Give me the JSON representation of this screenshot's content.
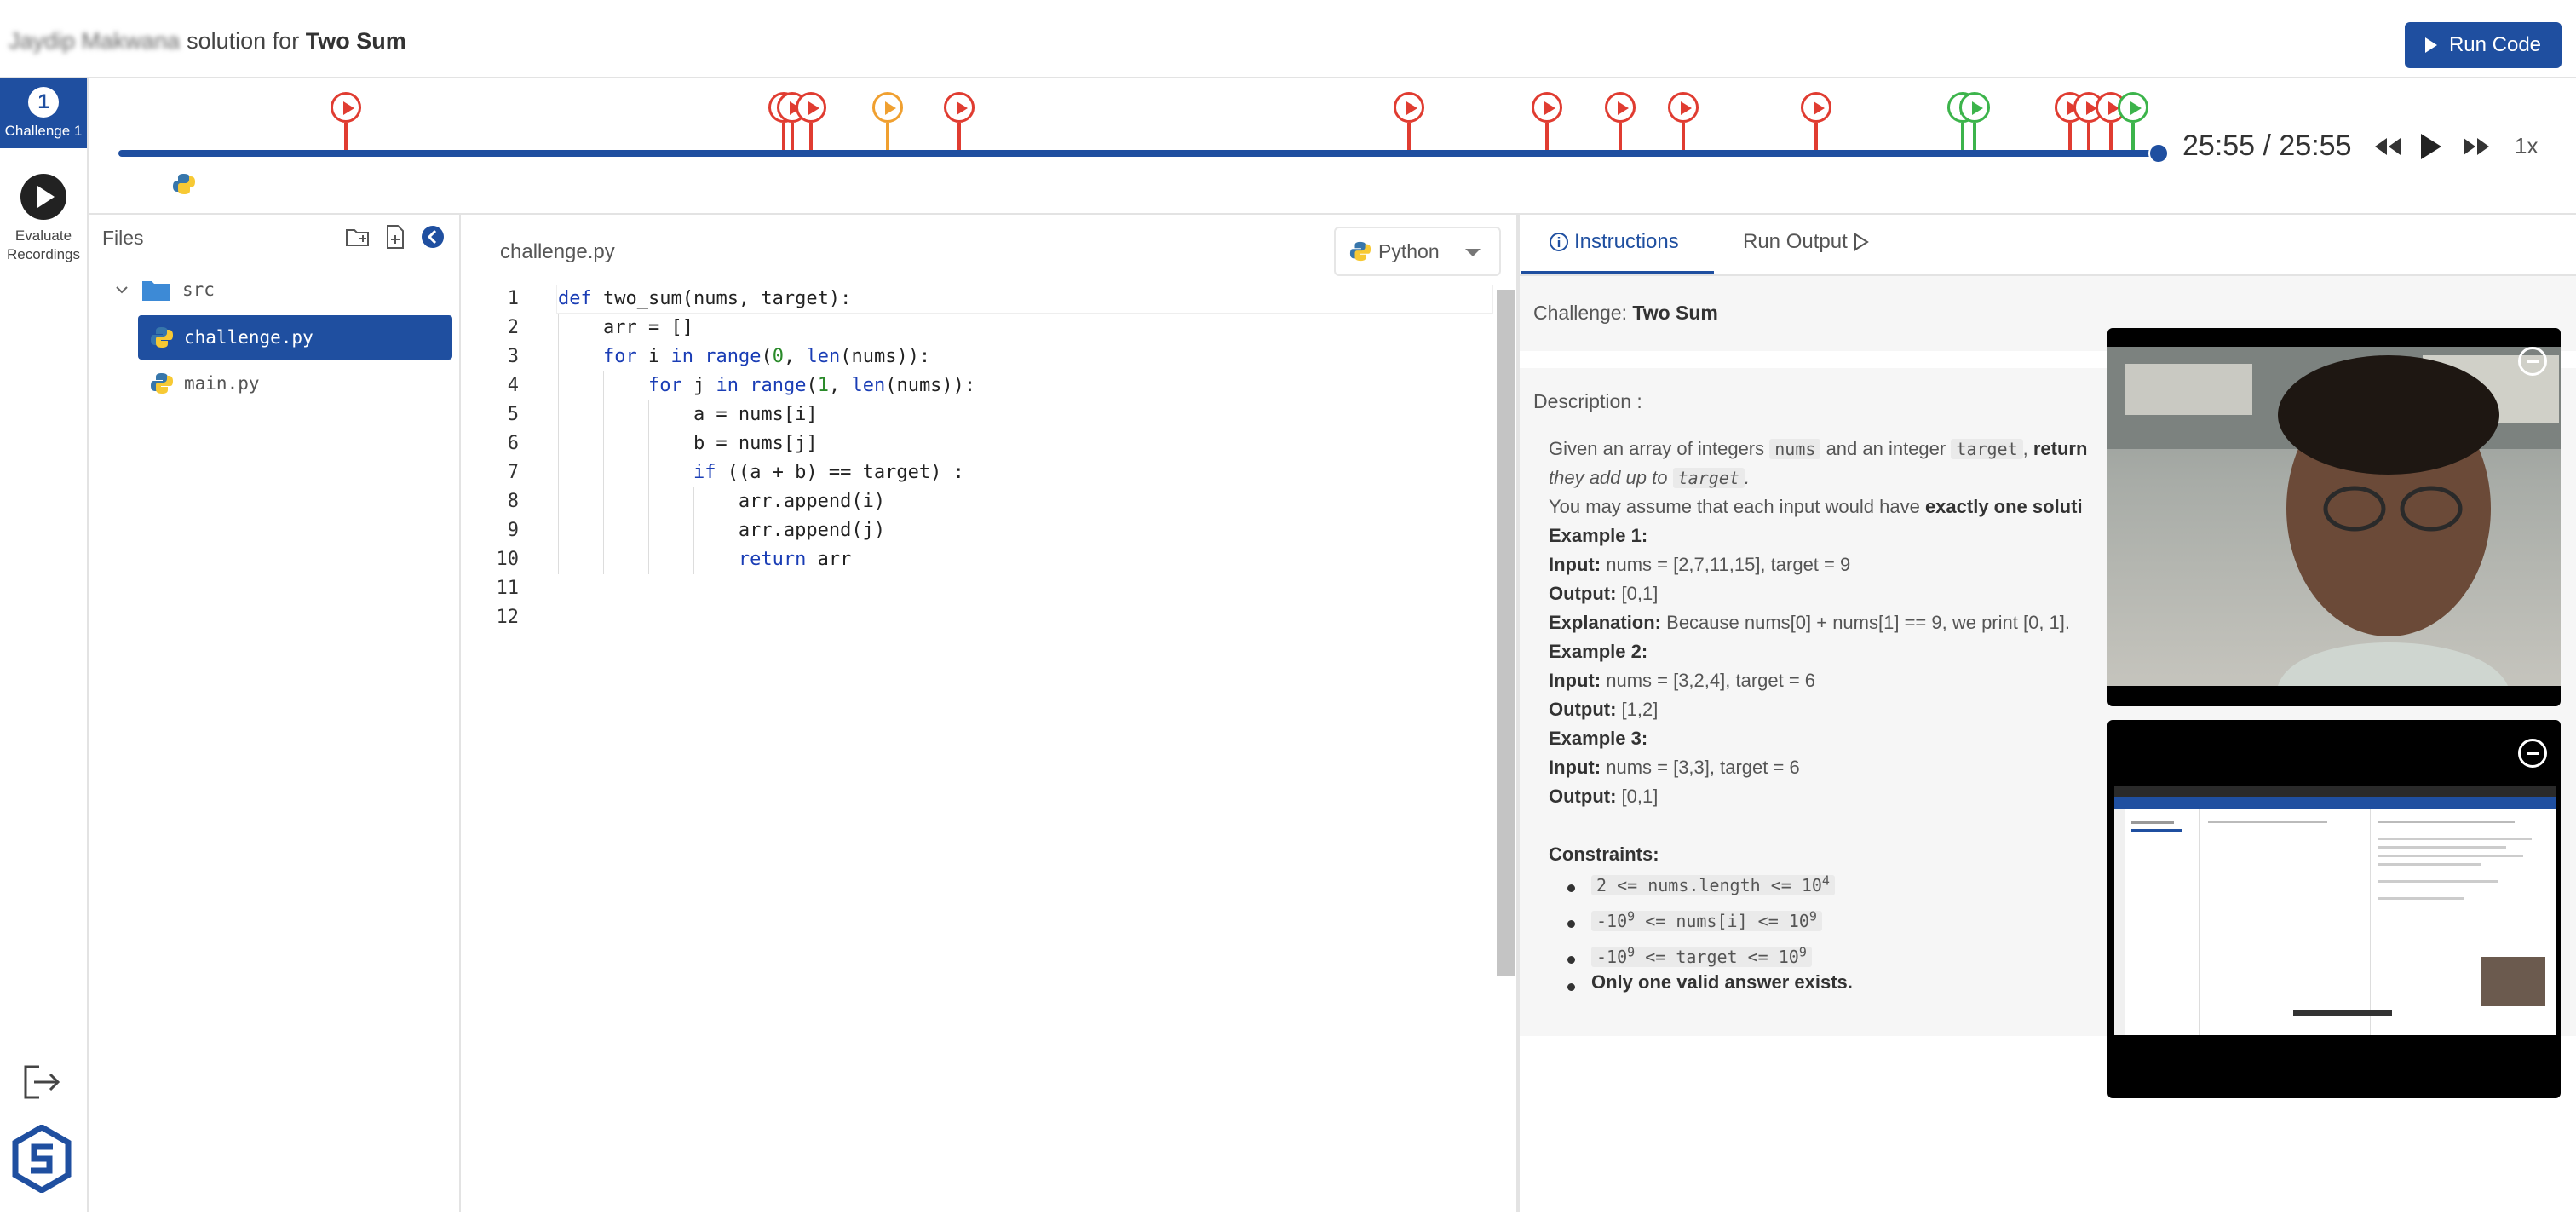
{
  "header": {
    "candidate_name": "Jaydip Makwana",
    "title_middle": "solution for",
    "challenge_name": "Two Sum",
    "run_button": "Run Code"
  },
  "rail": {
    "challenge_number": "1",
    "challenge_label": "Challenge 1",
    "evaluate_label_1": "Evaluate",
    "evaluate_label_2": "Recordings"
  },
  "timeline": {
    "time_display": "25:55 / 25:55",
    "speed": "1x",
    "progress": 1.0,
    "colors": {
      "red": "#e03c31",
      "orange": "#f0a030",
      "green": "#3cb44b",
      "track": "#1f4fa0"
    }
  },
  "files": {
    "header": "Files",
    "folder": "src",
    "items": [
      "challenge.py",
      "main.py"
    ],
    "active": "challenge.py"
  },
  "editor": {
    "filename": "challenge.py",
    "language": "Python",
    "line_numbers": [
      "1",
      "2",
      "3",
      "4",
      "5",
      "6",
      "7",
      "8",
      "9",
      "10",
      "11",
      "12"
    ],
    "lines": [
      "def two_sum(nums, target):",
      "    arr = []",
      "    for i in range(0, len(nums)):",
      "        for j in range(1, len(nums)):",
      "            a = nums[i]",
      "            b = nums[j]",
      "            if ((a + b) == target) :",
      "                arr.append(i)",
      "                arr.append(j)",
      "                return arr",
      "",
      ""
    ]
  },
  "instructions": {
    "tab_instructions": "Instructions",
    "tab_output": "Run Output",
    "challenge_label": "Challenge:",
    "challenge_name": "Two Sum",
    "description_label": "Description :",
    "intro_1": "Given an array of integers",
    "intro_nums": "nums",
    "intro_2": "and an integer",
    "intro_target": "target",
    "intro_3": ",",
    "intro_return": "return",
    "intro_line2": "they add up to",
    "intro_line2_target": "target",
    "intro_line2_end": ".",
    "assume_1": "You may assume that each input would have",
    "assume_bold": "exactly one soluti",
    "ex1": "Example 1:",
    "ex1_input_lbl": "Input:",
    "ex1_input": "nums = [2,7,11,15], target = 9",
    "ex1_output_lbl": "Output:",
    "ex1_output": "[0,1]",
    "ex1_expl_lbl": "Explanation:",
    "ex1_expl": "Because nums[0] + nums[1] == 9, we print [0, 1].",
    "ex2": "Example 2:",
    "ex2_input_lbl": "Input:",
    "ex2_input": "nums = [3,2,4], target = 6",
    "ex2_output_lbl": "Output:",
    "ex2_output": "[1,2]",
    "ex3": "Example 3:",
    "ex3_input_lbl": "Input:",
    "ex3_input": "nums = [3,3], target = 6",
    "ex3_output_lbl": "Output:",
    "ex3_output": "[0,1]",
    "constraints_label": "Constraints:",
    "c1": "2 <= nums.length <= 10",
    "c1_sup": "4",
    "c2_a": "-10",
    "c2_sup1": "9",
    "c2_b": " <= nums[i] <= 10",
    "c2_sup2": "9",
    "c3_a": "-10",
    "c3_sup1": "9",
    "c3_b": " <= target <= 10",
    "c3_sup2": "9",
    "c4": "Only one valid answer exists."
  }
}
